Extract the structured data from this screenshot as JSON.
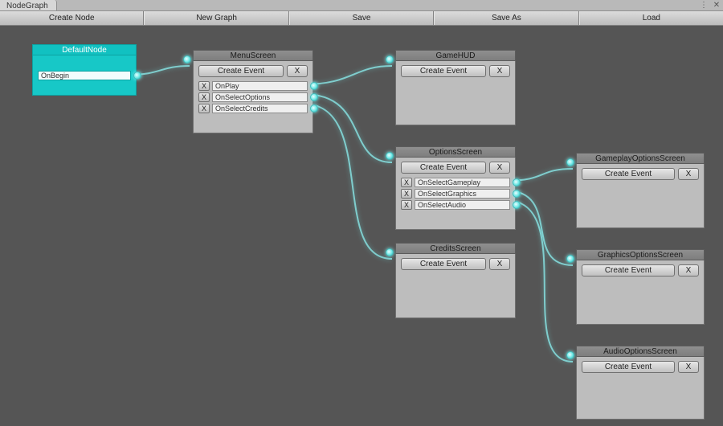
{
  "window": {
    "tab_label": "NodeGraph",
    "close_glyph": "✕",
    "lock_glyph": "⋮"
  },
  "toolbar": {
    "create_node": "Create Node",
    "new_graph": "New Graph",
    "save": "Save",
    "save_as": "Save As",
    "load": "Load"
  },
  "buttons": {
    "create_event": "Create Event",
    "x": "X"
  },
  "nodes": {
    "default": {
      "title": "DefaultNode",
      "events": [
        "OnBegin"
      ]
    },
    "menu": {
      "title": "MenuScreen",
      "events": [
        "OnPlay",
        "OnSelectOptions",
        "OnSelectCredits"
      ]
    },
    "gamehud": {
      "title": "GameHUD",
      "events": []
    },
    "options": {
      "title": "OptionsScreen",
      "events": [
        "OnSelectGameplay",
        "OnSelectGraphics",
        "OnSelectAudio"
      ]
    },
    "credits": {
      "title": "CreditsScreen",
      "events": []
    },
    "gp_opts": {
      "title": "GameplayOptionsScreen",
      "events": []
    },
    "gfx_opts": {
      "title": "GraphicsOptionsScreen",
      "events": []
    },
    "audio_opts": {
      "title": "AudioOptionsScreen",
      "events": []
    }
  }
}
